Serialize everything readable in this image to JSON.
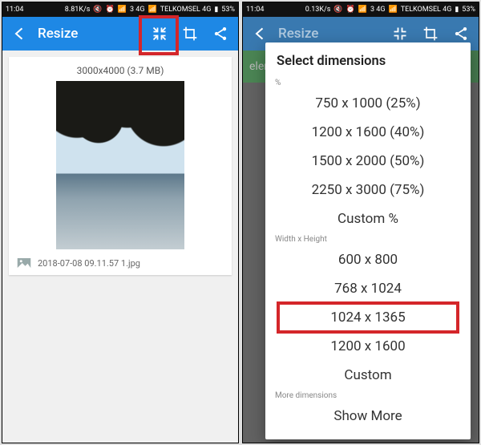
{
  "status": {
    "time": "11:04",
    "speed_left": "8.81K/s",
    "speed_right": "0.13K/s",
    "sim1": "3 4G",
    "sim2": "TELKOMSEL 4G",
    "battery": "53%"
  },
  "left": {
    "title": "Resize",
    "image_caption": "3000x4000 (3.7 MB)",
    "file_name": "2018-07-08 09.11.57 1.jpg"
  },
  "right": {
    "title": "Resize",
    "banner": "elem",
    "dialog_title": "Select dimensions",
    "sections": {
      "percent": "%",
      "wh": "Width x Height",
      "more": "More dimensions"
    },
    "opts_percent": [
      "750 x 1000  (25%)",
      "1200 x 1600  (40%)",
      "1500 x 2000  (50%)",
      "2250 x 3000  (75%)",
      "Custom %"
    ],
    "opts_wh": [
      "600 x 800",
      "768 x 1024",
      "1024 x 1365",
      "1200 x 1600",
      "Custom"
    ],
    "show_more": "Show More"
  }
}
